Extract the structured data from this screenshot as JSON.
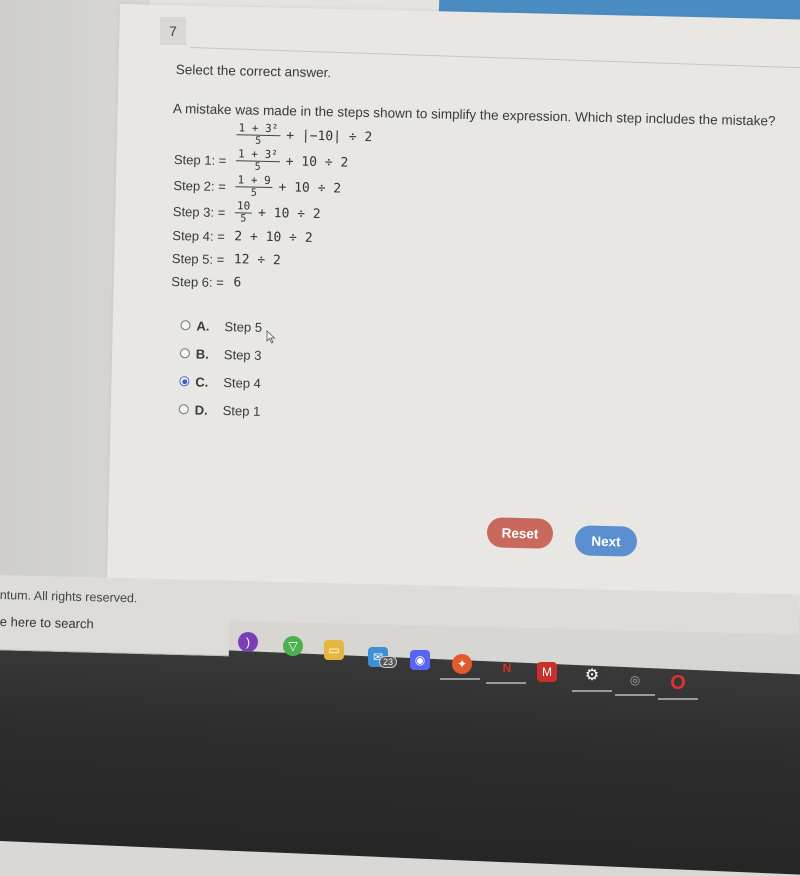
{
  "question": {
    "number": "7",
    "instruction": "Select the correct answer.",
    "prompt": "A mistake was made in the steps shown to simplify the expression. Which step includes the mistake?",
    "expression": {
      "fraction": {
        "numerator": "1 + 3²",
        "denominator": "5"
      },
      "rest": "+ |−10| ÷ 2"
    },
    "steps": [
      {
        "label": "Step 1: =",
        "fraction": {
          "numerator": "1 + 3²",
          "denominator": "5"
        },
        "rest": "+ 10 ÷ 2"
      },
      {
        "label": "Step 2: =",
        "fraction": {
          "numerator": "1 + 9",
          "denominator": "5"
        },
        "rest": "+ 10 ÷ 2"
      },
      {
        "label": "Step 3: =",
        "fraction": {
          "numerator": "10",
          "denominator": "5"
        },
        "rest": "+ 10 ÷ 2"
      },
      {
        "label": "Step 4: =",
        "rest": "2 + 10 ÷ 2"
      },
      {
        "label": "Step 5: =",
        "rest": "12 ÷ 2"
      },
      {
        "label": "Step 6: =",
        "rest": "6"
      }
    ],
    "choices": [
      {
        "letter": "A.",
        "text": "Step 5",
        "selected": false
      },
      {
        "letter": "B.",
        "text": "Step 3",
        "selected": false
      },
      {
        "letter": "C.",
        "text": "Step 4",
        "selected": true
      },
      {
        "letter": "D.",
        "text": "Step 1",
        "selected": false
      }
    ]
  },
  "buttons": {
    "reset_label": "Reset",
    "next_label": "Next"
  },
  "footer": {
    "copyright": "ntum. All rights reserved."
  },
  "taskbar": {
    "search_placeholder": "e here to search",
    "mail_badge": "23",
    "icons": [
      "podcast-icon",
      "vpn-icon",
      "file-explorer-icon",
      "mail-icon",
      "discord-icon",
      "brave-icon",
      "netflix-icon",
      "mcafee-icon",
      "settings-icon",
      "steam-icon",
      "opera-icon"
    ]
  },
  "colors": {
    "accent_blue": "#5b8fd0",
    "reset_red": "#c9685c",
    "radio_selected": "#3b63c2",
    "top_bar": "#4b8cc2"
  }
}
